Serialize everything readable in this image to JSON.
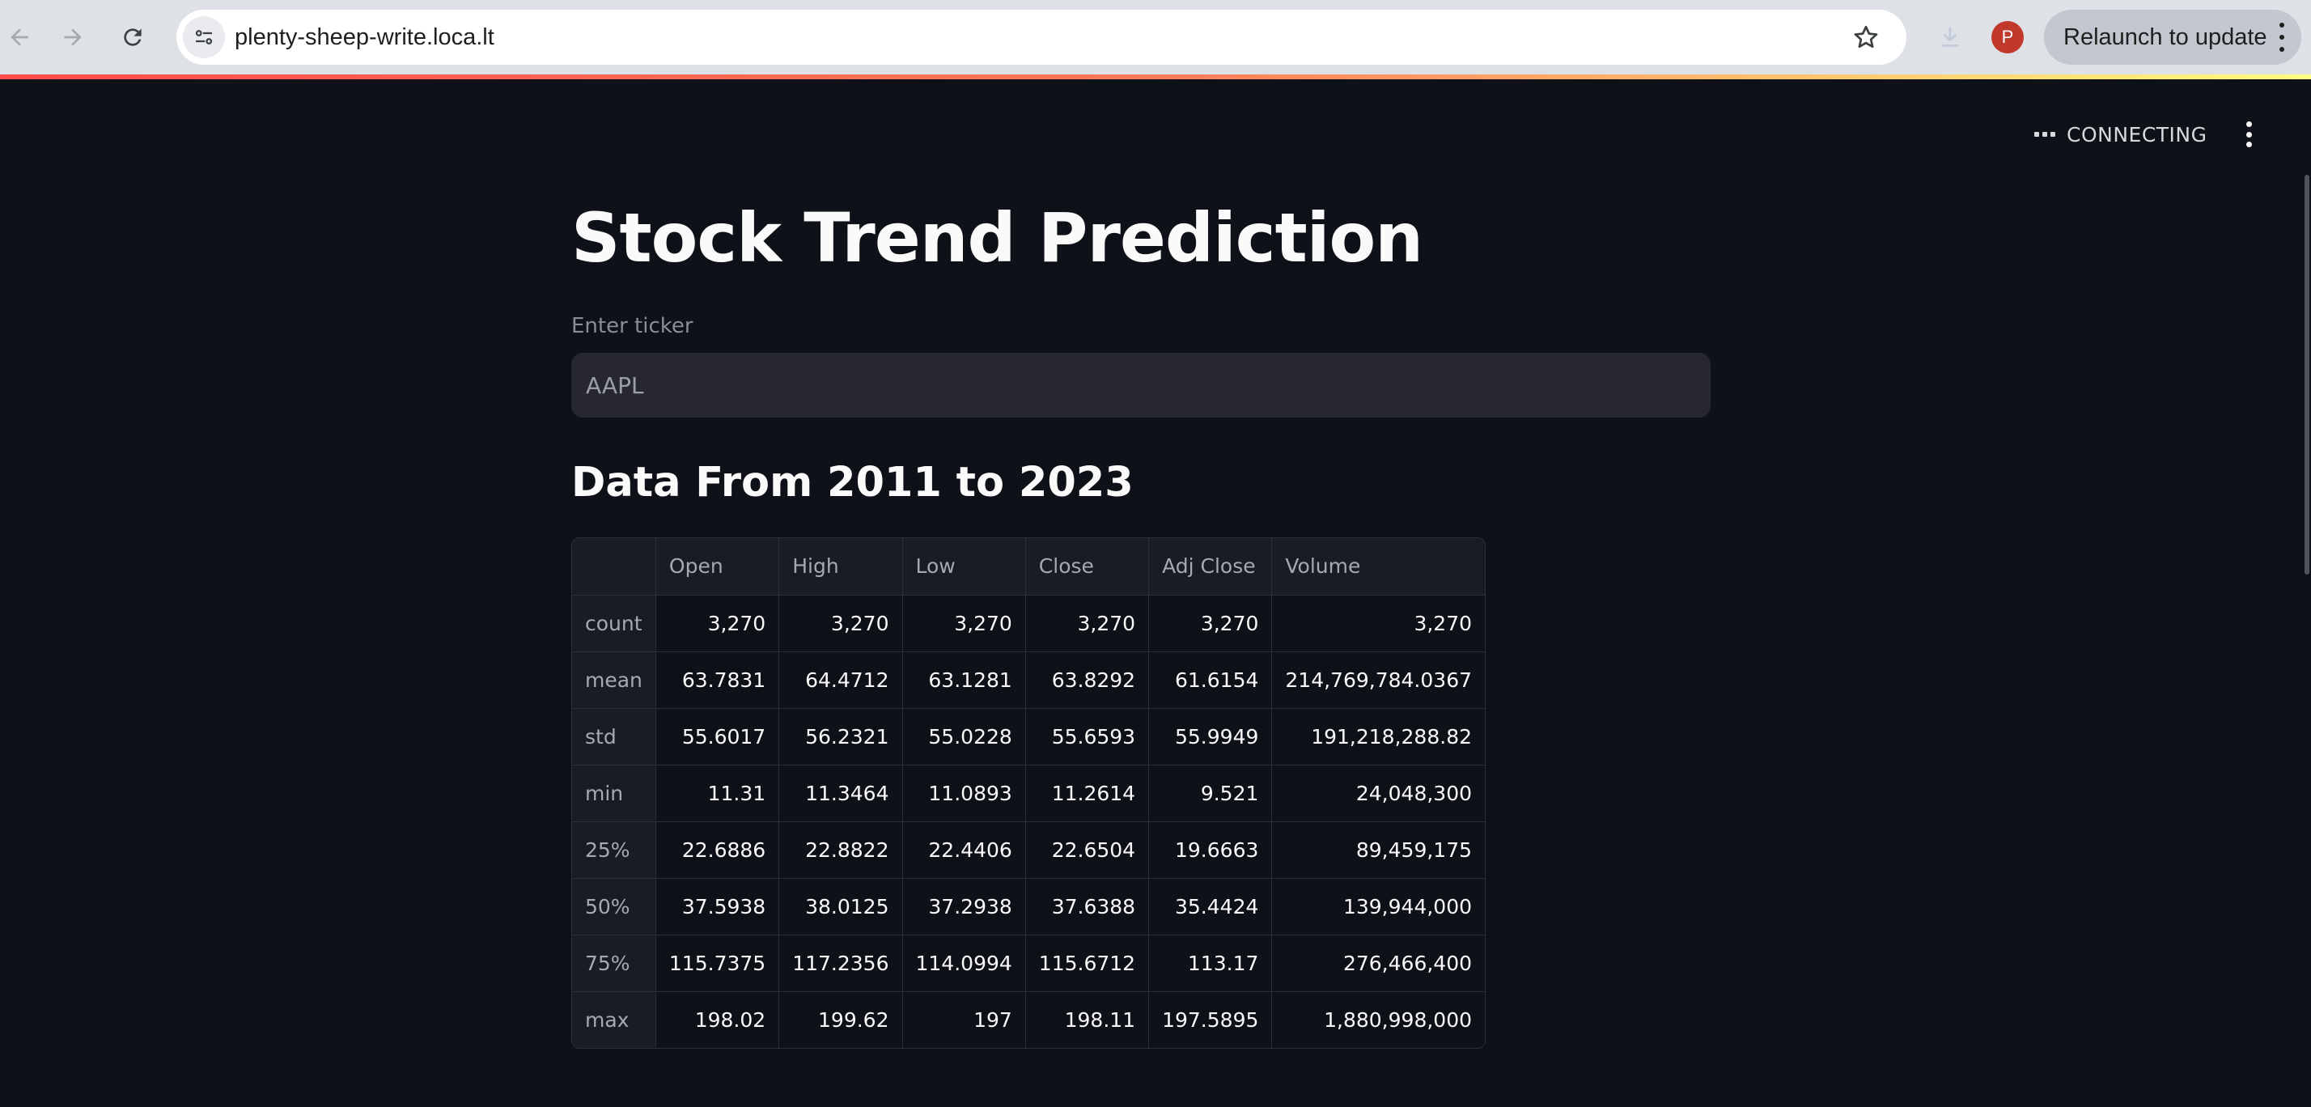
{
  "browser": {
    "url": "plenty-sheep-write.loca.lt",
    "profile_initial": "P",
    "relaunch_label": "Relaunch to update",
    "icons": [
      "back-arrow-icon",
      "forward-arrow-icon",
      "reload-icon",
      "site-info-icon",
      "star-icon",
      "download-icon",
      "kebab-menu-icon"
    ]
  },
  "app": {
    "status": "CONNECTING",
    "title": "Stock Trend Prediction",
    "ticker": {
      "label": "Enter ticker",
      "value": "AAPL"
    },
    "section_title": "Data From 2011 to 2023",
    "table": {
      "columns": [
        "",
        "Open",
        "High",
        "Low",
        "Close",
        "Adj Close",
        "Volume"
      ],
      "rows": [
        [
          "count",
          "3,270",
          "3,270",
          "3,270",
          "3,270",
          "3,270",
          "3,270"
        ],
        [
          "mean",
          "63.7831",
          "64.4712",
          "63.1281",
          "63.8292",
          "61.6154",
          "214,769,784.0367"
        ],
        [
          "std",
          "55.6017",
          "56.2321",
          "55.0228",
          "55.6593",
          "55.9949",
          "191,218,288.82"
        ],
        [
          "min",
          "11.31",
          "11.3464",
          "11.0893",
          "11.2614",
          "9.521",
          "24,048,300"
        ],
        [
          "25%",
          "22.6886",
          "22.8822",
          "22.4406",
          "22.6504",
          "19.6663",
          "89,459,175"
        ],
        [
          "50%",
          "37.5938",
          "38.0125",
          "37.2938",
          "37.6388",
          "35.4424",
          "139,944,000"
        ],
        [
          "75%",
          "115.7375",
          "117.2356",
          "114.0994",
          "115.6712",
          "113.17",
          "276,466,400"
        ],
        [
          "max",
          "198.02",
          "199.62",
          "197",
          "198.11",
          "197.5895",
          "1,880,998,000"
        ]
      ]
    }
  },
  "colors": {
    "app_background": "#0e1117",
    "input_background": "#262730",
    "text_primary": "#fafafa",
    "avatar": "#c0392b"
  }
}
